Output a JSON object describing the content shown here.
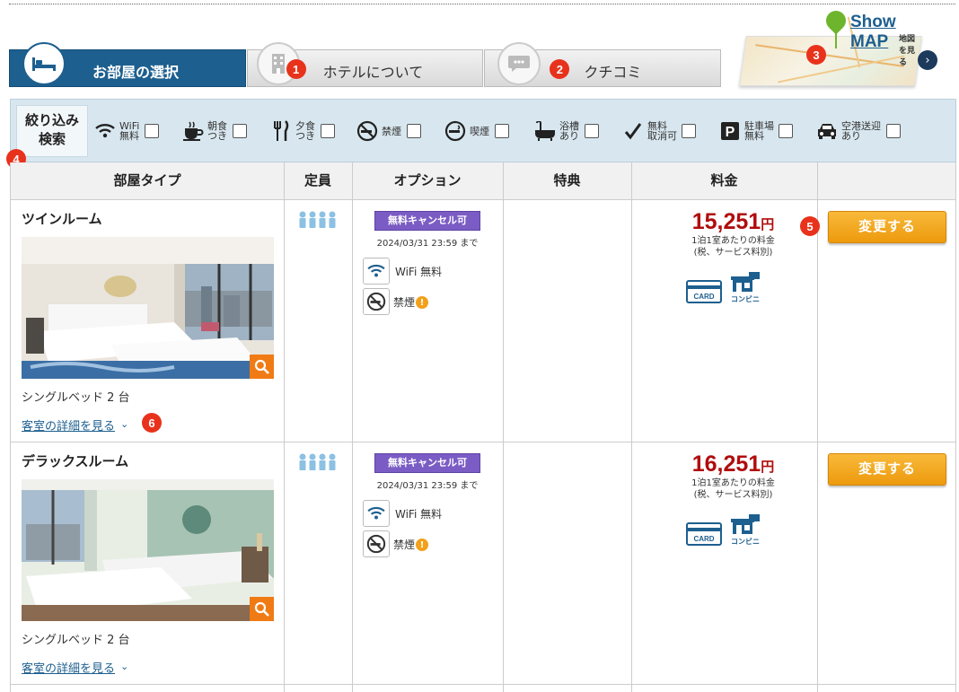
{
  "tabs": [
    {
      "label": "お部屋の選択",
      "icon": "bed-icon"
    },
    {
      "label": "ホテルについて",
      "icon": "building-icon",
      "badge": "1"
    },
    {
      "label": "クチコミ",
      "icon": "chat-icon",
      "badge": "2"
    }
  ],
  "map": {
    "title": "Show MAP",
    "subtitle": "地図を見る",
    "badge": "3"
  },
  "filter": {
    "label_line1": "絞り込み",
    "label_line2": "検索",
    "badge": "4",
    "items": [
      {
        "line1": "WiFi",
        "line2": "無料",
        "icon": "wifi-icon"
      },
      {
        "line1": "朝食",
        "line2": "つき",
        "icon": "breakfast-icon"
      },
      {
        "line1": "夕食",
        "line2": "つき",
        "icon": "dinner-icon"
      },
      {
        "line1": "禁煙",
        "line2": "",
        "icon": "no-smoking-icon"
      },
      {
        "line1": "喫煙",
        "line2": "",
        "icon": "smoking-icon"
      },
      {
        "line1": "浴槽",
        "line2": "あり",
        "icon": "bathtub-icon"
      },
      {
        "line1": "無料",
        "line2": "取消可",
        "icon": "check-icon"
      },
      {
        "line1": "駐車場",
        "line2": "無料",
        "icon": "parking-icon"
      },
      {
        "line1": "空港送迎",
        "line2": "あり",
        "icon": "car-icon"
      }
    ]
  },
  "table": {
    "headers": [
      "部屋タイプ",
      "定員",
      "オプション",
      "特典",
      "料金",
      ""
    ]
  },
  "rooms": [
    {
      "name": "ツインルーム",
      "bed": "シングルベッド 2 台",
      "detail": "客室の詳細を見る",
      "detail_badge": "6",
      "cancel_tag": "無料キャンセル可",
      "cancel_until": "2024/03/31 23:59 まで",
      "opt_wifi": "WiFi 無料",
      "opt_nosmoke": "禁煙",
      "price": "15,251",
      "yen": "円",
      "price_note1": "1泊1室あたりの料金",
      "price_note2": "(税、サービス料別)",
      "card_label": "CARD",
      "konbini_label": "コンビニ",
      "button": "変更する",
      "button_badge": "5",
      "warn_mark": "!"
    },
    {
      "name": "デラックスルーム",
      "bed": "シングルベッド 2 台",
      "detail": "客室の詳細を見る",
      "cancel_tag": "無料キャンセル可",
      "cancel_until": "2024/03/31 23:59 まで",
      "opt_wifi": "WiFi 無料",
      "opt_nosmoke": "禁煙",
      "price": "16,251",
      "yen": "円",
      "price_note1": "1泊1室あたりの料金",
      "price_note2": "(税、サービス料別)",
      "card_label": "CARD",
      "konbini_label": "コンビニ",
      "button": "変更する",
      "warn_mark": "!"
    }
  ],
  "colors": {
    "primary": "#1d5f8f",
    "accent": "#ed9a0d",
    "price": "#b00d0d",
    "badge": "#e8321b"
  }
}
